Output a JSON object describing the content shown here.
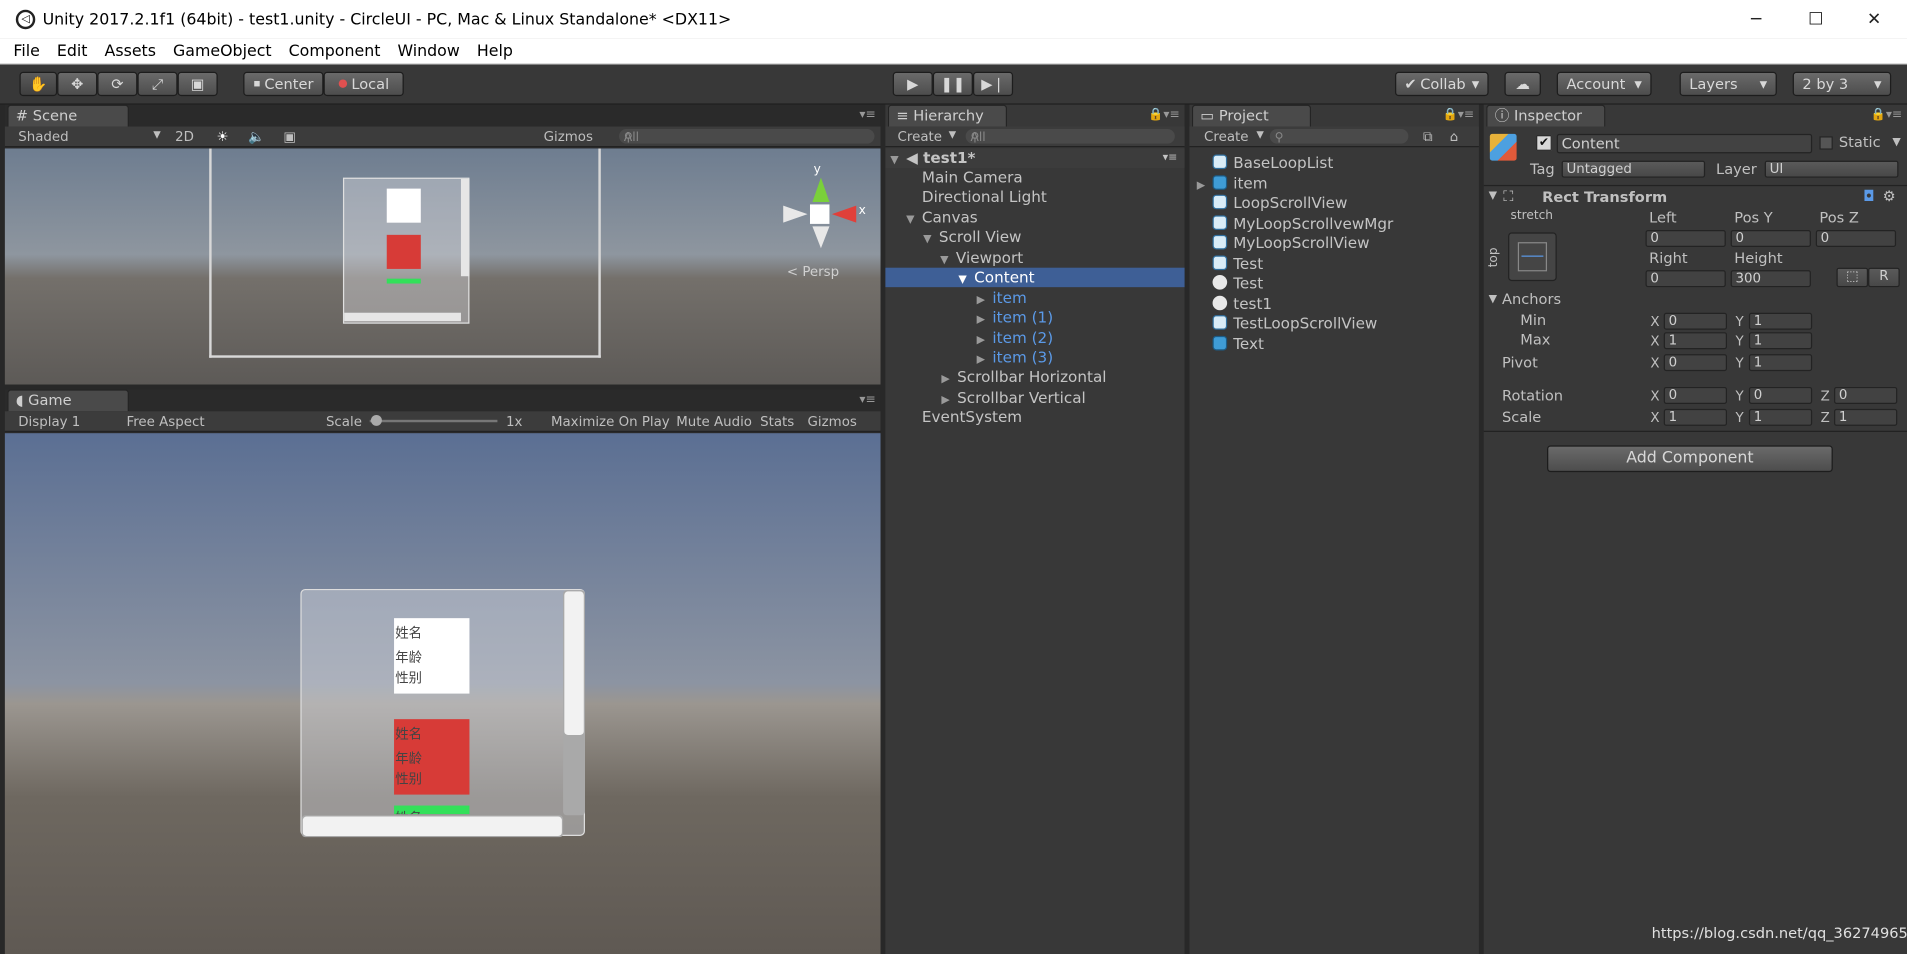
{
  "window": {
    "title": "Unity 2017.2.1f1 (64bit) - test1.unity - CircleUI - PC, Mac & Linux Standalone* <DX11>",
    "minimize": "─",
    "maximize": "☐",
    "close": "✕"
  },
  "menu": [
    "File",
    "Edit",
    "Assets",
    "GameObject",
    "Component",
    "Window",
    "Help"
  ],
  "toolbar": {
    "center": "Center",
    "local": "Local",
    "collab": "Collab",
    "account": "Account",
    "layers": "Layers",
    "layout": "2 by 3"
  },
  "scene": {
    "tab": "Scene",
    "shading": "Shaded",
    "mode2d": "2D",
    "gizmos": "Gizmos",
    "search_placeholder": "All",
    "persp": "< Persp",
    "axis_y": "y",
    "axis_x": "x"
  },
  "game": {
    "tab": "Game",
    "display": "Display 1",
    "aspect": "Free Aspect",
    "scale_label": "Scale",
    "scale_value": "1x",
    "maximize": "Maximize On Play",
    "mute": "Mute Audio",
    "stats": "Stats",
    "gizmos": "Gizmos",
    "items": [
      {
        "name": "姓名",
        "age": "年龄",
        "sex": "性别",
        "color": "#ffffff"
      },
      {
        "name": "姓名",
        "age": "年龄",
        "sex": "性别",
        "color": "#d73b37"
      },
      {
        "name": "姓名",
        "color": "#33e05a"
      }
    ]
  },
  "hierarchy": {
    "tab": "Hierarchy",
    "create": "Create",
    "search_placeholder": "All",
    "scene_name": "test1*",
    "nodes": [
      "Main Camera",
      "Directional Light",
      "Canvas",
      "Scroll View",
      "Viewport",
      "Content",
      "item",
      "item (1)",
      "item (2)",
      "item (3)",
      "Scrollbar Horizontal",
      "Scrollbar Vertical",
      "EventSystem"
    ]
  },
  "project": {
    "tab": "Project",
    "create": "Create",
    "items": [
      {
        "name": "BaseLoopList",
        "icon": "script-icon"
      },
      {
        "name": "item",
        "icon": "prefab-icon"
      },
      {
        "name": "LoopScrollView",
        "icon": "script-icon"
      },
      {
        "name": "MyLoopScrollvewMgr",
        "icon": "script-icon"
      },
      {
        "name": "MyLoopScrollView",
        "icon": "script-icon"
      },
      {
        "name": "Test",
        "icon": "script-icon"
      },
      {
        "name": "Test",
        "icon": "unity-scene-icon"
      },
      {
        "name": "test1",
        "icon": "unity-scene-icon"
      },
      {
        "name": "TestLoopScrollView",
        "icon": "script-icon"
      },
      {
        "name": "Text",
        "icon": "prefab-icon"
      }
    ]
  },
  "inspector": {
    "tab": "Inspector",
    "object_name": "Content",
    "static_label": "Static",
    "tag_label": "Tag",
    "tag_value": "Untagged",
    "layer_label": "Layer",
    "layer_value": "UI",
    "component": "Rect Transform",
    "stretch": "stretch",
    "top": "top",
    "left_label": "Left",
    "posy_label": "Pos Y",
    "posz_label": "Pos Z",
    "left_value": "0",
    "posy_value": "0",
    "posz_value": "0",
    "right_label": "Right",
    "height_label": "Height",
    "right_value": "0",
    "height_value": "300",
    "r_button": "R",
    "anchors_label": "Anchors",
    "min_label": "Min",
    "max_label": "Max",
    "min_x": "0",
    "min_y": "1",
    "max_x": "1",
    "max_y": "1",
    "pivot_label": "Pivot",
    "pivot_x": "0",
    "pivot_y": "1",
    "rotation_label": "Rotation",
    "rot_x": "0",
    "rot_y": "0",
    "rot_z": "0",
    "scale_label": "Scale",
    "scale_x": "1",
    "scale_y": "1",
    "scale_z": "1",
    "add_component": "Add Component",
    "x": "X",
    "y": "Y",
    "z": "Z"
  },
  "watermark": "https://blog.csdn.net/qq_36274965"
}
